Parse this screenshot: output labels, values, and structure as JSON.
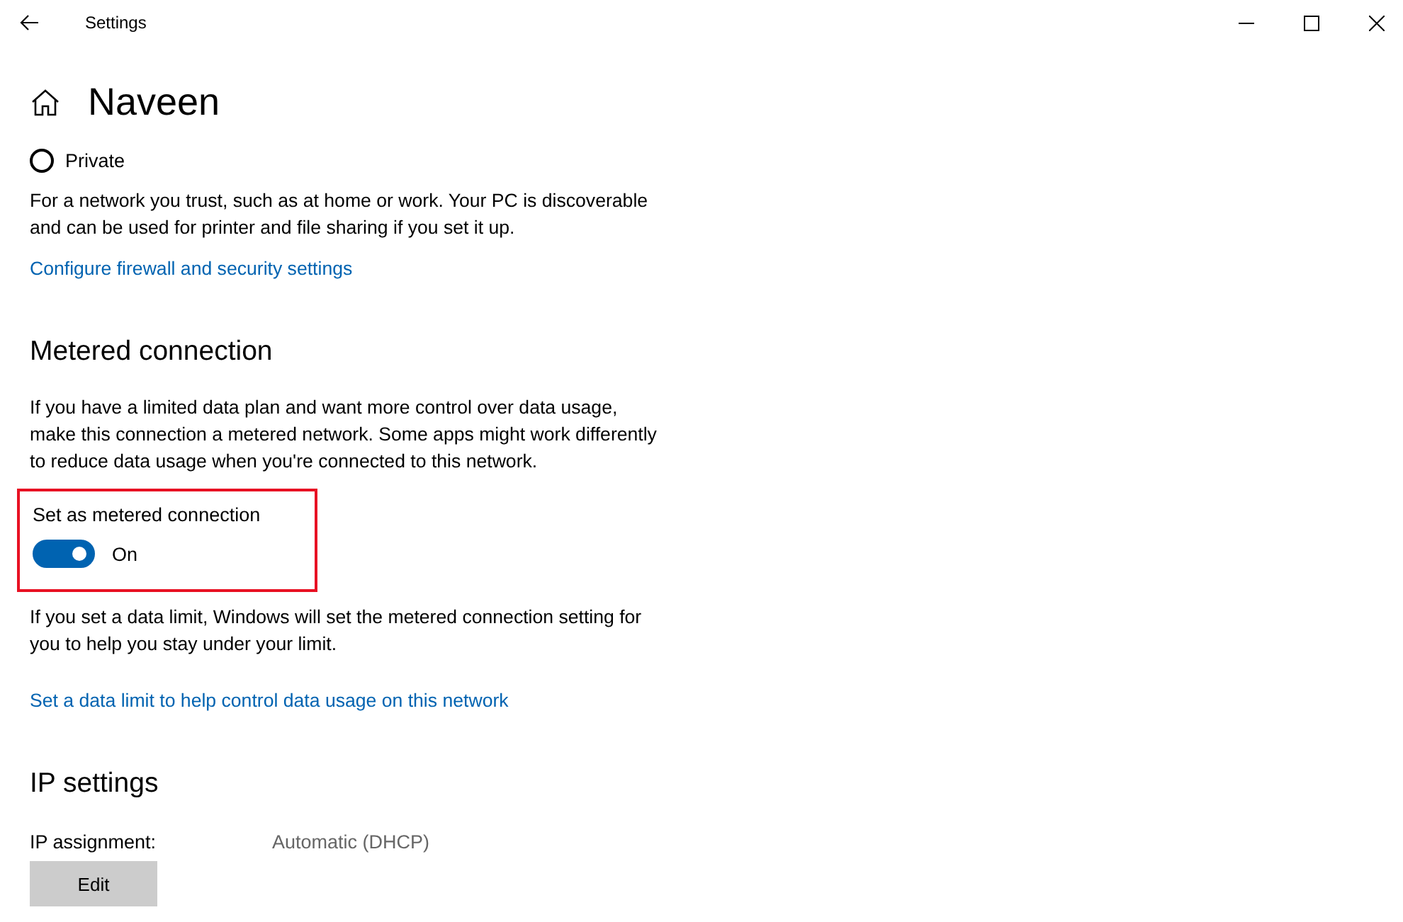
{
  "window": {
    "title": "Settings"
  },
  "page": {
    "title": "Naveen"
  },
  "network_profile": {
    "options": [
      {
        "label": "Private",
        "selected": false
      }
    ],
    "description": "For a network you trust, such as at home or work. Your PC is discoverable and can be used for printer and file sharing if you set it up.",
    "link": "Configure firewall and security settings"
  },
  "metered": {
    "heading": "Metered connection",
    "description": "If you have a limited data plan and want more control over data usage, make this connection a metered network. Some apps might work differently to reduce data usage when you're connected to this network.",
    "toggle": {
      "label": "Set as metered connection",
      "on": true,
      "state_text": "On",
      "highlighted": true
    },
    "note": "If you set a data limit, Windows will set the metered connection setting for you to help you stay under your limit.",
    "link": "Set a data limit to help control data usage on this network"
  },
  "ip": {
    "heading": "IP settings",
    "label": "IP assignment:",
    "value": "Automatic (DHCP)",
    "button": "Edit"
  }
}
